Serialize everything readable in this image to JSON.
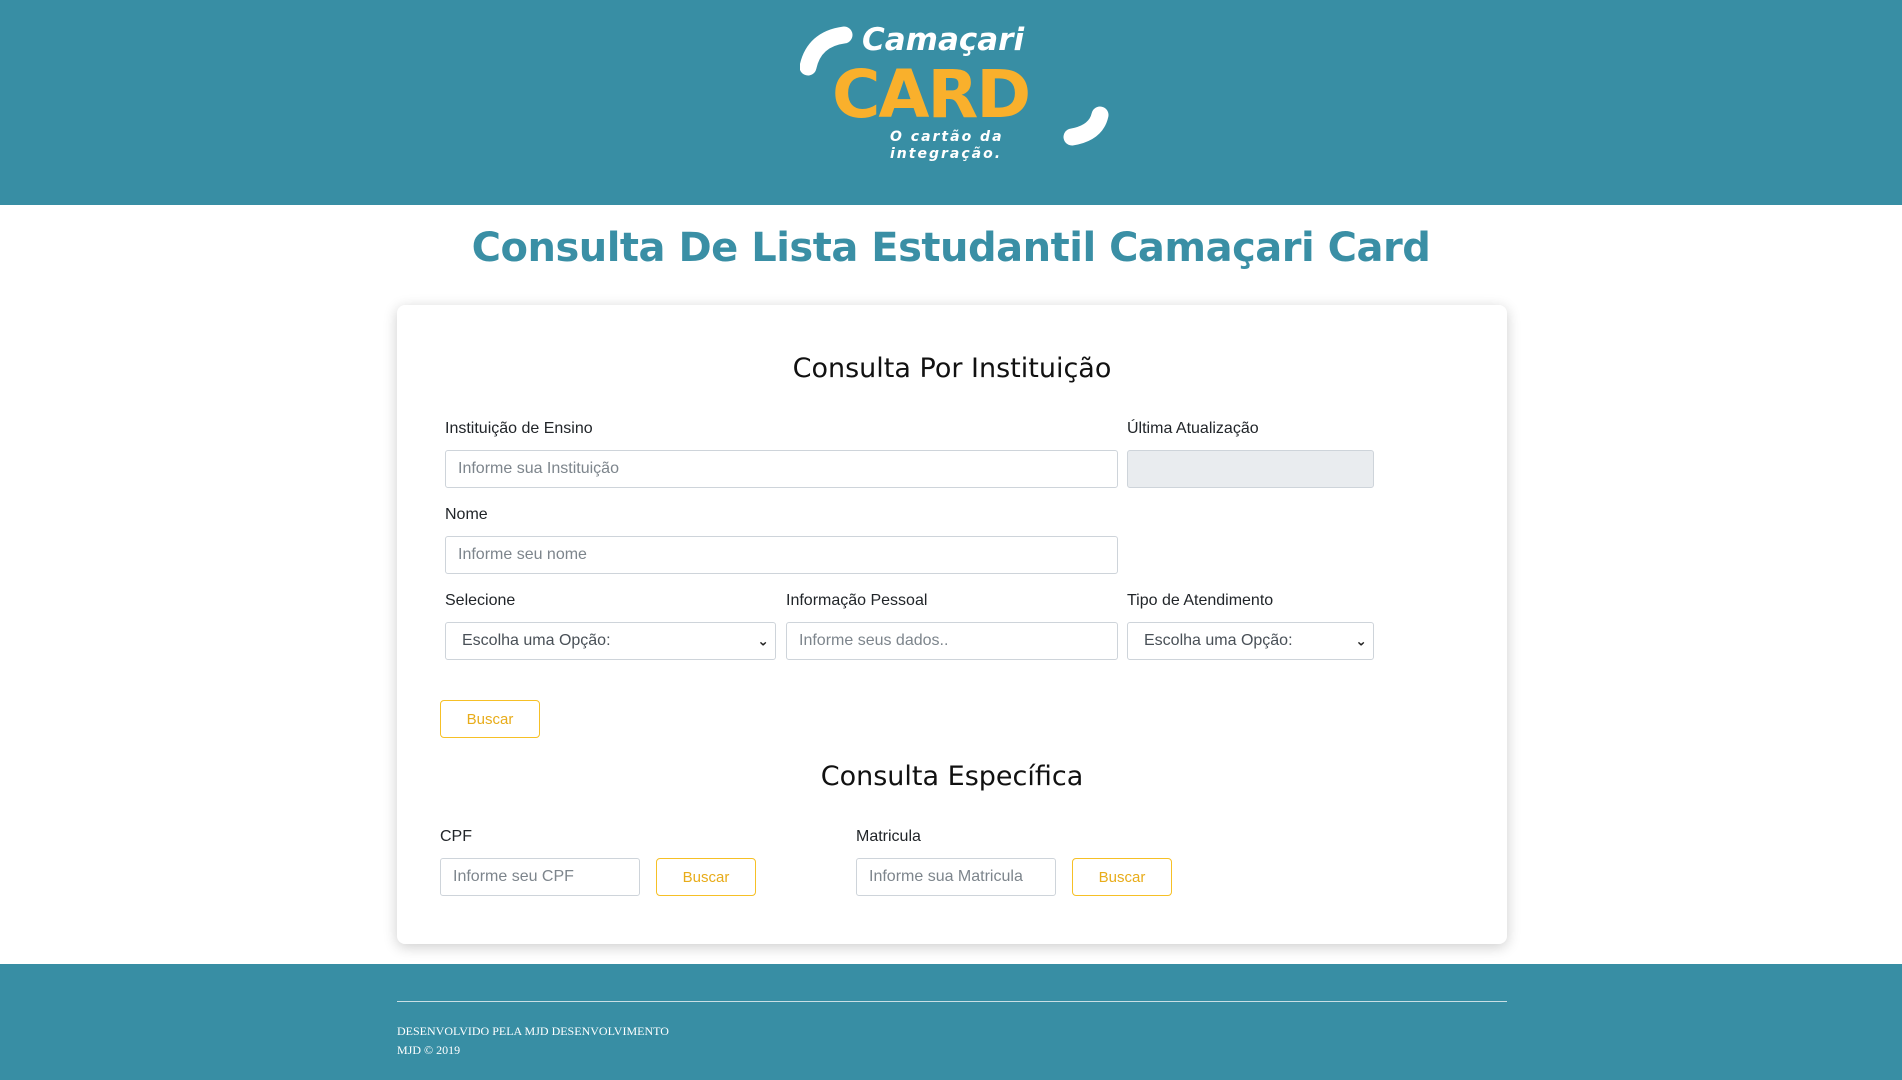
{
  "header": {
    "logo": {
      "word1": "Camaçari",
      "word2": "CARD",
      "tagline_line1": "O cartão da",
      "tagline_line2": "integração."
    }
  },
  "page_title": "Consulta De Lista Estudantil Camaçari Card",
  "institution_form": {
    "title": "Consulta Por Instituição",
    "institution": {
      "label": "Instituição de Ensino",
      "placeholder": "Informe sua Instituição",
      "value": ""
    },
    "last_update": {
      "label": "Última Atualização",
      "value": ""
    },
    "name": {
      "label": "Nome",
      "placeholder": "Informe seu nome",
      "value": ""
    },
    "select": {
      "label": "Selecione",
      "selected": "Escolha uma Opção:"
    },
    "personal_info": {
      "label": "Informação Pessoal",
      "placeholder": "Informe seus dados..",
      "value": ""
    },
    "service_type": {
      "label": "Tipo de Atendimento",
      "selected": "Escolha uma Opção:"
    },
    "search_button": "Buscar"
  },
  "specific_form": {
    "title": "Consulta Específica",
    "cpf": {
      "label": "CPF",
      "placeholder": "Informe seu CPF",
      "button": "Buscar"
    },
    "matricula": {
      "label": "Matricula",
      "placeholder": "Informe sua Matricula",
      "button": "Buscar"
    }
  },
  "footer": {
    "line1": "DESENVOLVIDO PELA MJD DESENVOLVIMENTO",
    "line2": "MJD © 2019"
  },
  "colors": {
    "brand_teal": "#388ea4",
    "brand_yellow": "#f9b02c",
    "button_accent": "#f6c026",
    "title_teal": "#3a8fa5"
  }
}
